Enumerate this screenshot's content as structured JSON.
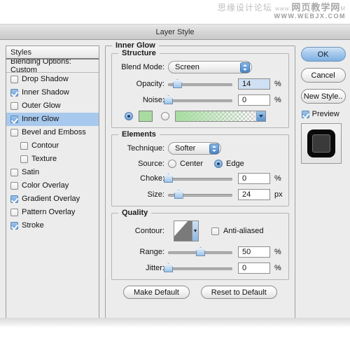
{
  "watermark": {
    "line1_cn": "思缘设计论坛",
    "line1_www": "www.",
    "line1_site": "网页教学网",
    "line1_suffix": "M",
    "line2": "WWW.WEBJX.COM"
  },
  "window": {
    "title": "Layer Style"
  },
  "styles_panel": {
    "header": "Styles",
    "blending_options": "Blending Options: Custom",
    "items": [
      {
        "label": "Drop Shadow",
        "checked": false,
        "selected": false,
        "indent": false
      },
      {
        "label": "Inner Shadow",
        "checked": true,
        "selected": false,
        "indent": false
      },
      {
        "label": "Outer Glow",
        "checked": false,
        "selected": false,
        "indent": false
      },
      {
        "label": "Inner Glow",
        "checked": true,
        "selected": true,
        "indent": false
      },
      {
        "label": "Bevel and Emboss",
        "checked": false,
        "selected": false,
        "indent": false
      },
      {
        "label": "Contour",
        "checked": false,
        "selected": false,
        "indent": true
      },
      {
        "label": "Texture",
        "checked": false,
        "selected": false,
        "indent": true
      },
      {
        "label": "Satin",
        "checked": false,
        "selected": false,
        "indent": false
      },
      {
        "label": "Color Overlay",
        "checked": false,
        "selected": false,
        "indent": false
      },
      {
        "label": "Gradient Overlay",
        "checked": true,
        "selected": false,
        "indent": false
      },
      {
        "label": "Pattern Overlay",
        "checked": false,
        "selected": false,
        "indent": false
      },
      {
        "label": "Stroke",
        "checked": true,
        "selected": false,
        "indent": false
      }
    ]
  },
  "panel": {
    "title": "Inner Glow",
    "structure": {
      "title": "Structure",
      "blend_mode_label": "Blend Mode:",
      "blend_mode_value": "Screen",
      "opacity_label": "Opacity:",
      "opacity_value": "14",
      "opacity_unit": "%",
      "opacity_percent": 14,
      "noise_label": "Noise:",
      "noise_value": "0",
      "noise_unit": "%",
      "noise_percent": 0,
      "fill_type": "color",
      "color_swatch": "#a8dba0",
      "gradient_from": "#a6dca0",
      "gradient_to": "rgba(166,220,160,0)"
    },
    "elements": {
      "title": "Elements",
      "technique_label": "Technique:",
      "technique_value": "Softer",
      "source_label": "Source:",
      "source_center": "Center",
      "source_edge": "Edge",
      "source_value": "Edge",
      "choke_label": "Choke:",
      "choke_value": "0",
      "choke_unit": "%",
      "choke_percent": 0,
      "size_label": "Size:",
      "size_value": "24",
      "size_unit": "px",
      "size_percent": 16
    },
    "quality": {
      "title": "Quality",
      "contour_label": "Contour:",
      "anti_aliased_label": "Anti-aliased",
      "anti_aliased_checked": false,
      "range_label": "Range:",
      "range_value": "50",
      "range_unit": "%",
      "range_percent": 50,
      "jitter_label": "Jitter:",
      "jitter_value": "0",
      "jitter_unit": "%",
      "jitter_percent": 0,
      "make_default": "Make Default",
      "reset_to_default": "Reset to Default"
    }
  },
  "actions": {
    "ok": "OK",
    "cancel": "Cancel",
    "new_style": "New Style..",
    "preview_label": "Preview",
    "preview_checked": true
  }
}
